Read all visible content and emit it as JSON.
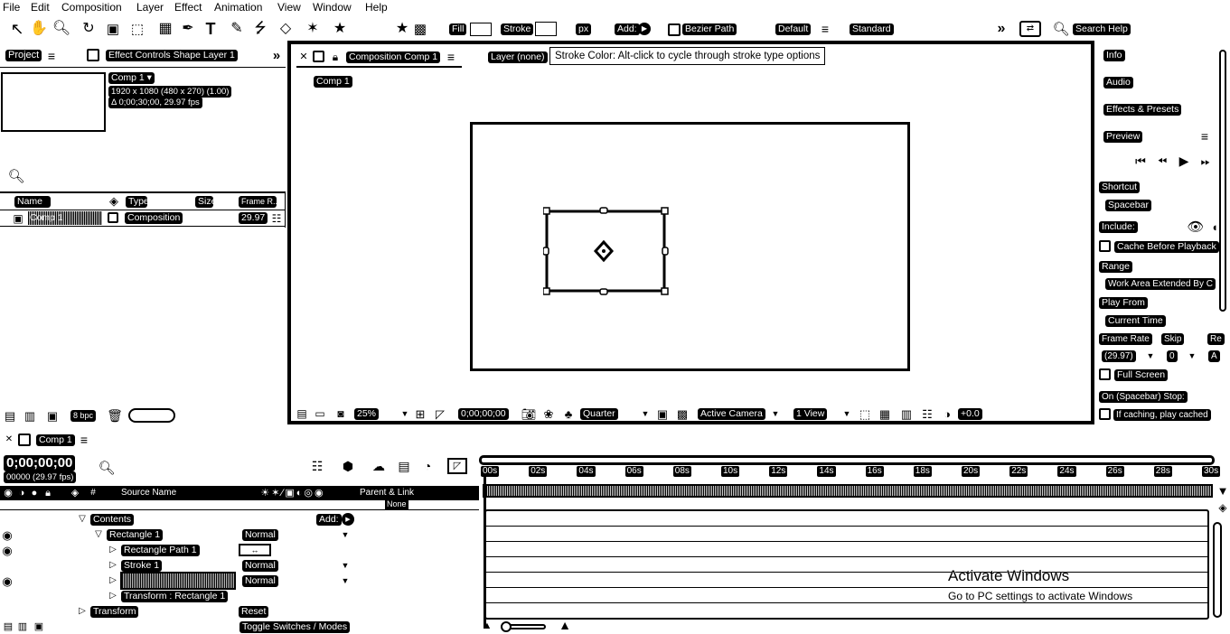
{
  "menu": [
    "File",
    "Edit",
    "Composition",
    "Layer",
    "Effect",
    "Animation",
    "View",
    "Window",
    "Help"
  ],
  "toolbar": {
    "fill_label": "Fill",
    "stroke_label": "Stroke",
    "px_label": "px",
    "add_label": "Add:",
    "bezier_label": "Bezier Path",
    "workspace_default": "Default",
    "workspace_standard": "Standard",
    "search_help": "Search Help"
  },
  "project_panel": {
    "tab_project": "Project",
    "tab_effect_controls": "Effect Controls Shape Layer 1",
    "comp_name": "Comp 1 ▾",
    "comp_size": "1920 x 1080  (480 x 270) (1.00)",
    "comp_duration": "Δ 0;00;30;00, 29.97 fps",
    "columns": [
      "Name",
      "Type",
      "Size",
      "Frame R..."
    ],
    "row": {
      "name": "Comp 1",
      "type": "Composition",
      "fps": "29.97"
    },
    "bpc": "8 bpc"
  },
  "composition_panel": {
    "tab_label": "Composition Comp 1",
    "layer_label": "Layer (none)",
    "tooltip": "Stroke Color: Alt-click to cycle through stroke type options",
    "breadcrumb": "Comp 1",
    "zoom": "25%",
    "timecode": "0;00;00;00",
    "resolution": "Quarter",
    "camera": "Active Camera",
    "views": "1 View",
    "exposure": "+0.0"
  },
  "right_panel": {
    "items": [
      "Info",
      "Audio",
      "Effects & Presets",
      "Preview"
    ],
    "shortcut_label": "Shortcut",
    "shortcut_value": "Spacebar",
    "include_label": "Include:",
    "cache_label": "Cache Before Playback",
    "range_label": "Range",
    "range_value": "Work Area Extended By C",
    "play_from_label": "Play From",
    "play_from_value": "Current Time",
    "frame_rate_label": "Frame Rate",
    "skip_label": "Skip",
    "res_label": "Re",
    "frame_rate_value": "(29.97)",
    "skip_value": "0",
    "res_value": "A",
    "full_screen": "Full Screen",
    "on_stop_label": "On (Spacebar) Stop:",
    "on_stop_value": "If caching, play cached"
  },
  "timeline": {
    "tab_label": "Comp 1",
    "current_time": "0;00;00;00",
    "frame_info": "00000 (29.97 fps)",
    "col_source_name": "Source Name",
    "col_parent": "Parent & Link",
    "col_none": "None",
    "ruler": [
      "00s",
      "02s",
      "04s",
      "06s",
      "08s",
      "10s",
      "12s",
      "14s",
      "16s",
      "18s",
      "20s",
      "22s",
      "24s",
      "26s",
      "28s",
      "30s"
    ],
    "layers": [
      {
        "name": "Contents",
        "mode": "",
        "extra": "Add:"
      },
      {
        "name": "Rectangle 1",
        "mode": "Normal"
      },
      {
        "name": "Rectangle Path 1",
        "mode": ""
      },
      {
        "name": "Stroke 1",
        "mode": "Normal"
      },
      {
        "name": "",
        "mode": "Normal"
      },
      {
        "name": "Transform : Rectangle 1",
        "mode": ""
      },
      {
        "name": "Transform",
        "mode": "Reset"
      }
    ],
    "toggle_label": "Toggle Switches / Modes"
  },
  "watermark": {
    "title": "Activate Windows",
    "subtitle": "Go to PC settings to activate Windows"
  }
}
